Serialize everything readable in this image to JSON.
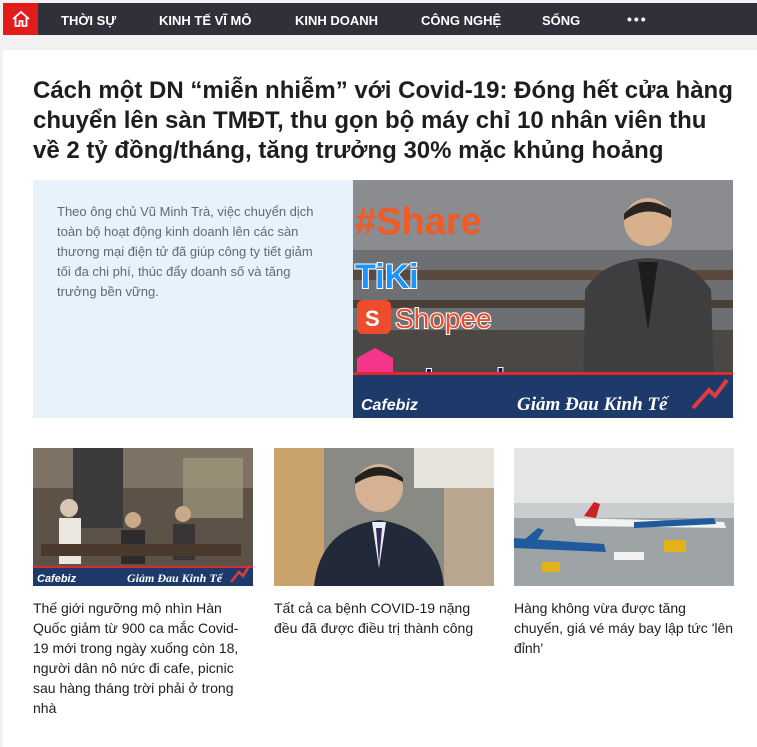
{
  "nav": {
    "items": [
      "THỜI SỰ",
      "KINH TẾ VĨ MÔ",
      "KINH DOANH",
      "CÔNG NGHỆ",
      "SỐNG"
    ],
    "more": "•••"
  },
  "featured": {
    "headline": "Cách một DN “miễn nhiễm” với Covid-19: Đóng hết cửa hàng chuyển lên sàn TMĐT, thu gọn bộ máy chỉ 10 nhân viên thu về 2 tỷ đồng/tháng, tăng trưởng 30% mặc khủng hoảng",
    "sapo": "Theo ông chủ Vũ Minh Trà, việc chuyển dịch toàn bộ hoạt động kinh doanh lên các sàn thương mại điện tử đã giúp công ty tiết giảm tối đa chi phí, thúc đẩy doanh số và tăng trưởng bền vững.",
    "image": {
      "hashtag": "#Share",
      "brands": [
        "TiKi",
        "Shopee",
        "Lazada"
      ],
      "brand_label": "Cafebiz",
      "banner": "Giảm Đau Kinh Tế"
    }
  },
  "cards": [
    {
      "title": "Thế giới ngưỡng mộ nhìn Hàn Quốc giảm từ 900 ca mắc Covid-19 mới trong ngày xuống còn 18, người dân nô nức đi cafe, picnic sau hàng tháng trời phải ở trong nhà",
      "brand": "Cafebiz",
      "banner": "Giảm Đau Kinh Tế"
    },
    {
      "title": "Tất cả ca bệnh COVID-19 nặng đều đã được điều trị thành công"
    },
    {
      "title": "Hàng không vừa được tăng chuyến, giá vé máy bay lập tức 'lên đỉnh'"
    }
  ],
  "colors": {
    "nav_bg": "#2f3039",
    "home_bg": "#e21b1b",
    "sapo_bg": "#e8f2fb",
    "hashtag": "#f15a22",
    "shopee": "#ee4d2d",
    "tiki": "#1a94ff"
  }
}
